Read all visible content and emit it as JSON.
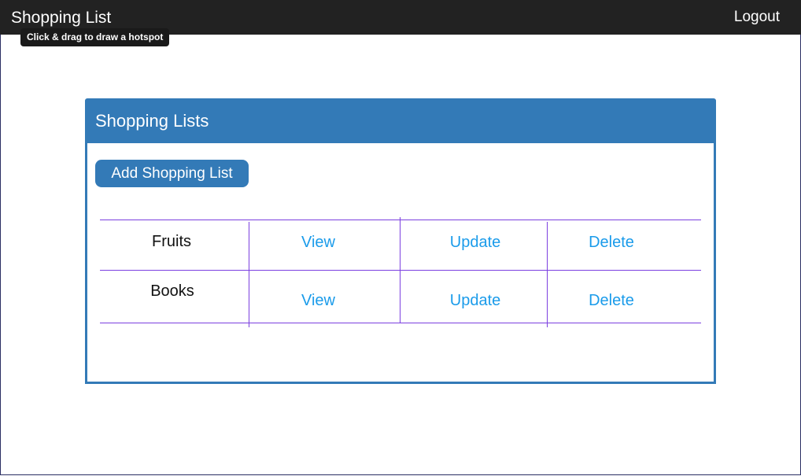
{
  "navbar": {
    "brand": "Shopping List",
    "logout_label": "Logout"
  },
  "tooltip": {
    "text": "Click & drag to draw a hotspot"
  },
  "panel": {
    "title": "Shopping Lists",
    "add_button_label": "Add Shopping List"
  },
  "lists": [
    {
      "name": "Fruits",
      "view_label": "View",
      "update_label": "Update",
      "delete_label": "Delete"
    },
    {
      "name": "Books",
      "view_label": "View",
      "update_label": "Update",
      "delete_label": "Delete"
    }
  ],
  "colors": {
    "navbar_bg": "#222222",
    "primary": "#337ab7",
    "link": "#1a9bea",
    "table_border": "#7b3fe0"
  }
}
